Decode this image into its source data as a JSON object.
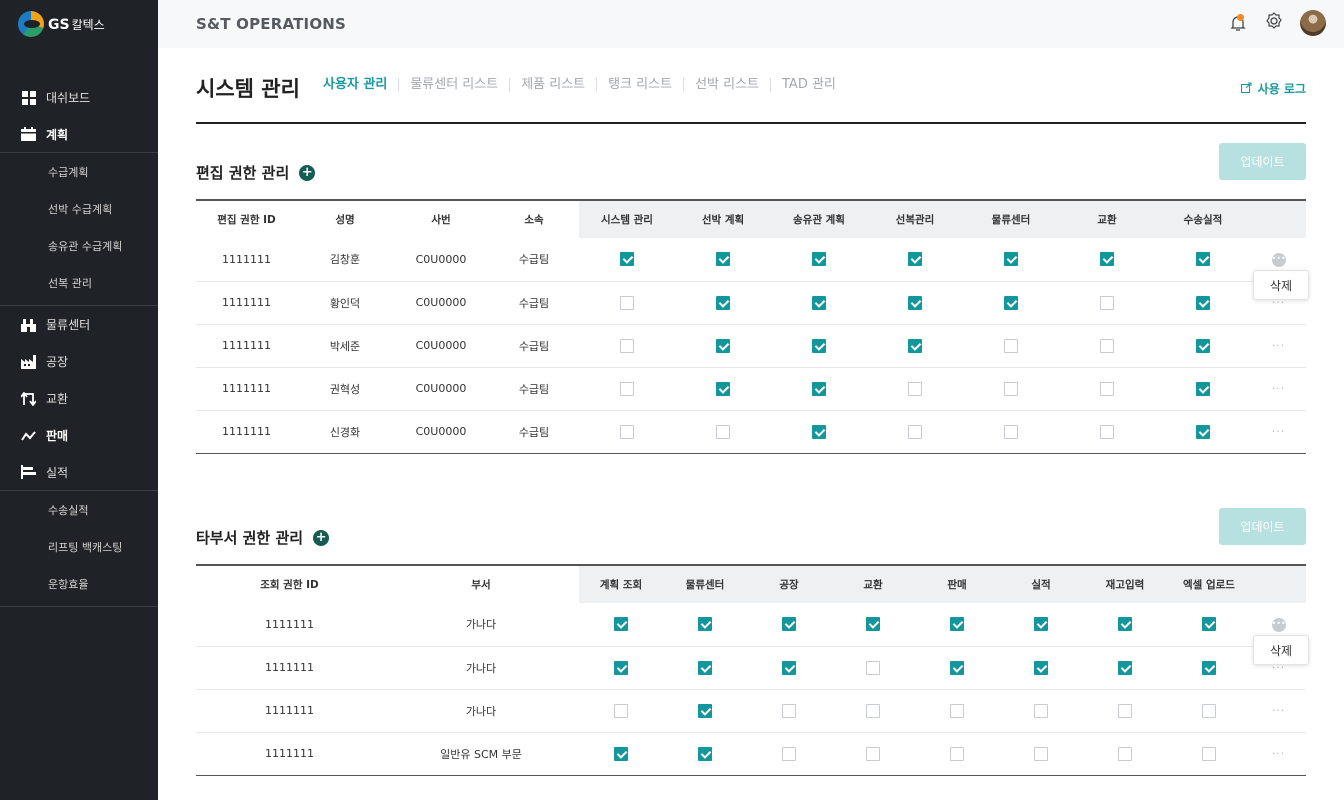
{
  "brand": {
    "name_en": "GS",
    "name_ko": "칼텍스"
  },
  "topbar": {
    "title": "S&T OPERATIONS"
  },
  "sidebar": {
    "items": [
      {
        "label": "대쉬보드",
        "icon": "grid-icon",
        "bold": false
      },
      {
        "label": "계획",
        "icon": "calendar-icon",
        "bold": true,
        "children": [
          "수급계획",
          "선박 수급계획",
          "송유관 수급계획",
          "선복 관리"
        ]
      },
      {
        "label": "물류센터",
        "icon": "warehouse-icon",
        "bold": false
      },
      {
        "label": "공장",
        "icon": "factory-icon",
        "bold": false
      },
      {
        "label": "교환",
        "icon": "exchange-icon",
        "bold": false
      },
      {
        "label": "판매",
        "icon": "trend-icon",
        "bold": true
      },
      {
        "label": "실적",
        "icon": "bar-list-icon",
        "bold": false,
        "children": [
          "수송실적",
          "리프팅 백캐스팅",
          "운항효율"
        ]
      }
    ]
  },
  "header": {
    "title": "시스템 관리",
    "tabs": [
      "사용자 관리",
      "물류센터 리스트",
      "제품 리스트",
      "탱크 리스트",
      "선박 리스트",
      "TAD 관리"
    ],
    "active_tab": 0,
    "log_link": "사용 로그"
  },
  "edit_section": {
    "title": "편집 권한 관리",
    "update_label": "업데이트",
    "columns": [
      "편집 권한 ID",
      "성명",
      "사번",
      "소속",
      "시스템 관리",
      "선박 계획",
      "송유관 계획",
      "선복관리",
      "물류센터",
      "교환",
      "수송실적"
    ],
    "rows": [
      {
        "id": "1111111",
        "name": "김창훈",
        "emp": "C0U0000",
        "team": "수급팀",
        "perms": [
          1,
          1,
          1,
          1,
          1,
          1,
          1
        ]
      },
      {
        "id": "1111111",
        "name": "황인덕",
        "emp": "C0U0000",
        "team": "수급팀",
        "perms": [
          0,
          1,
          1,
          1,
          1,
          0,
          1
        ]
      },
      {
        "id": "1111111",
        "name": "박세준",
        "emp": "C0U0000",
        "team": "수급팀",
        "perms": [
          0,
          1,
          1,
          1,
          0,
          0,
          1
        ]
      },
      {
        "id": "1111111",
        "name": "권혁성",
        "emp": "C0U0000",
        "team": "수급팀",
        "perms": [
          0,
          1,
          1,
          0,
          0,
          0,
          1
        ]
      },
      {
        "id": "1111111",
        "name": "신경화",
        "emp": "C0U0000",
        "team": "수급팀",
        "perms": [
          0,
          0,
          1,
          0,
          0,
          0,
          1
        ]
      }
    ],
    "popup_label": "삭제"
  },
  "dept_section": {
    "title": "타부서 권한 관리",
    "update_label": "업데이트",
    "columns": [
      "조회 권한 ID",
      "부서",
      "계획 조회",
      "물류센터",
      "공장",
      "교환",
      "판매",
      "실적",
      "재고입력",
      "엑셀 업로드"
    ],
    "rows": [
      {
        "id": "1111111",
        "dept": "가나다",
        "perms": [
          1,
          1,
          1,
          1,
          1,
          1,
          1,
          1
        ]
      },
      {
        "id": "1111111",
        "dept": "가나다",
        "perms": [
          1,
          1,
          1,
          0,
          1,
          1,
          1,
          1
        ]
      },
      {
        "id": "1111111",
        "dept": "가나다",
        "perms": [
          0,
          1,
          0,
          0,
          0,
          0,
          0,
          0
        ]
      },
      {
        "id": "1111111",
        "dept": "일반유 SCM 부문",
        "perms": [
          1,
          1,
          0,
          0,
          0,
          0,
          0,
          0
        ]
      }
    ],
    "popup_label": "삭제"
  },
  "colors": {
    "accent": "#13969c",
    "sidebar_bg": "#1f2226",
    "update_btn": "#b7e0e0",
    "plus": "#155c52"
  }
}
